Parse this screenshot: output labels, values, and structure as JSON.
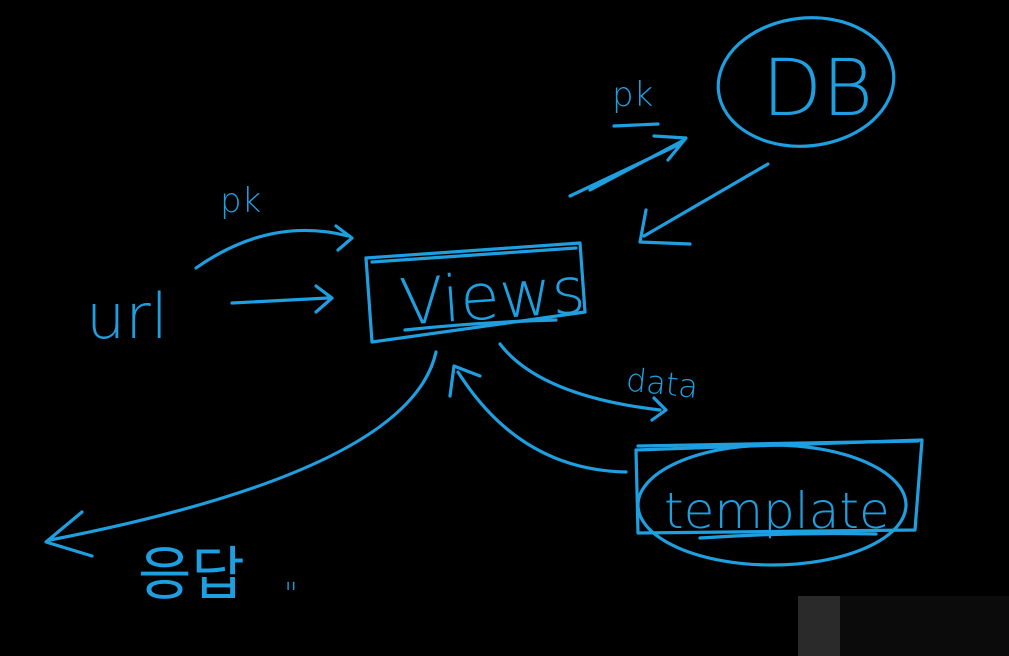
{
  "colors": {
    "background": "#000000",
    "ink": "#1e9fe0"
  },
  "nodes": {
    "views": "Views",
    "db": "DB",
    "template": "template",
    "url": "url",
    "response": "응답"
  },
  "edges": {
    "url_pk": "pk",
    "views_db_pk": "pk",
    "views_template_data": "data"
  },
  "annotations": {
    "quote_mark": "\""
  }
}
